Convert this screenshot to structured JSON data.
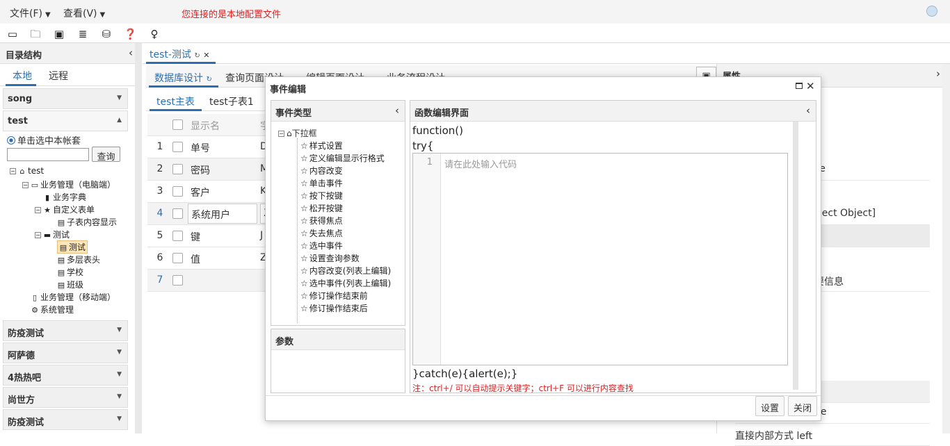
{
  "menubar": {
    "file": "文件(F)",
    "view": "查看(V)",
    "notice": "您连接的是本地配置文件"
  },
  "left": {
    "title": "目录结构",
    "tabs": [
      "本地",
      "远程"
    ],
    "group_song": "song",
    "group_test": "test",
    "radio_label": "单击选中本帐套",
    "search_button": "查询",
    "tree": {
      "root": "test",
      "biz_pc": "业务管理（电脑端）",
      "dict": "业务字典",
      "custom_form": "自定义表单",
      "sub_display": "子表内容显示",
      "test_folder": "测试",
      "test_item": "测试",
      "multi_header": "多层表头",
      "school": "学校",
      "class": "班级",
      "biz_mobile": "业务管理（移动端）",
      "sys": "系统管理"
    },
    "groups_bottom": [
      "防疫测试",
      "阿萨德",
      "4热热吧",
      "尚世方",
      "防疫测试"
    ]
  },
  "center": {
    "doc_tab": "test-测试",
    "subtabs": [
      "数据库设计",
      "查询页面设计",
      "编辑页面设计",
      "业务流程设计"
    ],
    "table_tabs": [
      "test主表",
      "test子表1"
    ],
    "grid_header": "显示名",
    "grid_header2": "字",
    "rows": [
      {
        "num": "1",
        "name": "单号",
        "c2": "D"
      },
      {
        "num": "2",
        "name": "密码",
        "c2": "M"
      },
      {
        "num": "3",
        "name": "客户",
        "c2": "K"
      },
      {
        "num": "4",
        "name": "系统用户",
        "c2": "X"
      },
      {
        "num": "5",
        "name": "键",
        "c2": "J"
      },
      {
        "num": "6",
        "name": "值",
        "c2": "Z"
      },
      {
        "num": "7",
        "name": "",
        "c2": ""
      }
    ]
  },
  "right": {
    "title": "属性",
    "values": [
      "se",
      "bject Object]",
      "要信息",
      "ue",
      "直接内部方式 left"
    ]
  },
  "modal": {
    "title": "事件编辑",
    "event_type_title": "事件类型",
    "event_root": "下拉框",
    "events": [
      "样式设置",
      "定义编辑显示行格式",
      "内容改变",
      "单击事件",
      "按下按键",
      "松开按键",
      "获得焦点",
      "失去焦点",
      "选中事件",
      "设置查询参数",
      "内容改变(列表上编辑)",
      "选中事件(列表上编辑)",
      "修订操作结束前",
      "修订操作结束后"
    ],
    "param_title": "参数",
    "func_title": "函数编辑界面",
    "code_line1": "function()",
    "code_line2": "try{",
    "line_number": "1",
    "placeholder": "请在此处输入代码",
    "code_end": "}catch(e){alert(e);}",
    "hint": "注：ctrl+/ 可以自动提示关键字；ctrl+F 可以进行内容查找",
    "btn_settings": "设置",
    "btn_close": "关闭"
  }
}
